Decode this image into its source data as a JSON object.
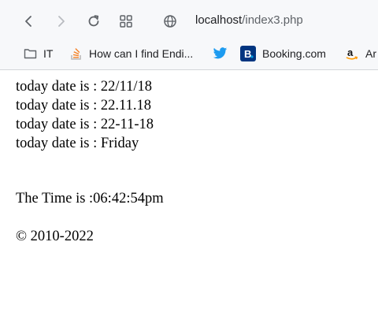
{
  "browser": {
    "url_host": "localhost",
    "url_path": "/index3.php",
    "bookmarks": [
      {
        "label": "IT",
        "icon": "folder-icon"
      },
      {
        "label": "How can I find Endi...",
        "icon": "stackoverflow-icon"
      },
      {
        "label": "",
        "icon": "twitter-icon"
      },
      {
        "label": "Booking.com",
        "icon": "booking-icon"
      },
      {
        "label": "Ar",
        "icon": "amazon-icon"
      }
    ]
  },
  "page": {
    "lines": [
      "today date is : 22/11/18",
      "today date is : 22.11.18",
      "today date is : 22-11-18",
      "today date is : Friday"
    ],
    "time": "The Time is :06:42:54pm",
    "copyright": "© 2010-2022"
  },
  "colors": {
    "toolbar_bg": "#f7f8fa",
    "twitter": "#1d9bf0",
    "booking": "#003580",
    "stackoverflow": "#f48024"
  }
}
